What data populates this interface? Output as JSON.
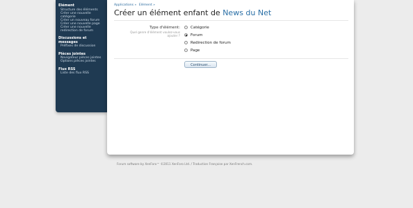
{
  "sidebar": {
    "sections": [
      {
        "heading": "Elément",
        "links": [
          "Structure des éléments",
          "Créer une nouvelle",
          "catégorie",
          "Créer un nouveau forum",
          "Créer une nouvelle page",
          "Créer une nouvelle",
          "redirection de forum"
        ]
      },
      {
        "heading": "Discussions et messages",
        "links": [
          "Préfixes de discussion"
        ]
      },
      {
        "heading": "Pièces jointes",
        "links": [
          "Navigateur pièces jointes",
          "Options pièces jointes"
        ]
      },
      {
        "heading": "Flux RSS",
        "links": [
          "Liste des flux RSS"
        ]
      }
    ]
  },
  "breadcrumb": [
    "Applications »",
    "Elément »"
  ],
  "title": {
    "prefix": "Créer un élément enfant de ",
    "forum_name": "News du Net"
  },
  "form": {
    "label": "Type d'élément:",
    "hint_line1": "Quel genre d'élément voulez-vous",
    "hint_line2": "ajouter ?",
    "options": [
      {
        "label": "Catégorie",
        "checked": false
      },
      {
        "label": "Forum",
        "checked": true
      },
      {
        "label": "Redirection de forum",
        "checked": false
      },
      {
        "label": "Page",
        "checked": false
      }
    ],
    "submit_label": "Continuer..."
  },
  "footer": {
    "text": "Forum software by XenForo™ ©2011 XenForo Ltd. / Traduction Française par XenFrench.com."
  }
}
